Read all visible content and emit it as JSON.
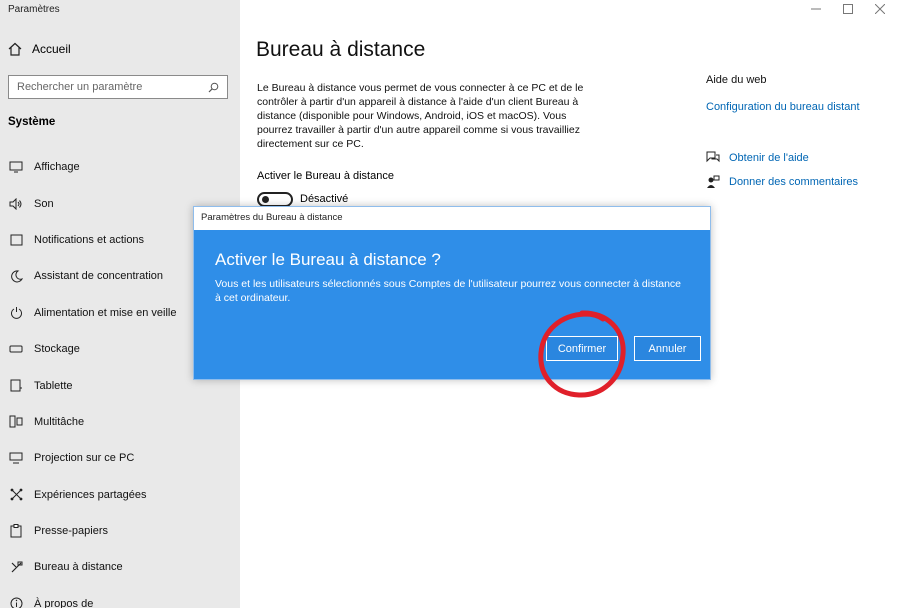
{
  "app": {
    "title": "Paramètres",
    "window_controls": [
      "minimize-icon",
      "maximize-icon",
      "close-icon"
    ]
  },
  "sidebar": {
    "home_label": "Accueil",
    "search_placeholder": "Rechercher un paramètre",
    "section": "Système",
    "items": [
      {
        "label": "Affichage",
        "icon": "display-icon"
      },
      {
        "label": "Son",
        "icon": "sound-icon"
      },
      {
        "label": "Notifications et actions",
        "icon": "notifications-icon"
      },
      {
        "label": "Assistant de concentration",
        "icon": "moon-icon"
      },
      {
        "label": "Alimentation et mise en veille",
        "icon": "power-icon"
      },
      {
        "label": "Stockage",
        "icon": "storage-icon"
      },
      {
        "label": "Tablette",
        "icon": "tablet-icon"
      },
      {
        "label": "Multitâche",
        "icon": "multitask-icon"
      },
      {
        "label": "Projection sur ce PC",
        "icon": "projection-icon"
      },
      {
        "label": "Expériences partagées",
        "icon": "shared-icon"
      },
      {
        "label": "Presse-papiers",
        "icon": "clipboard-icon"
      },
      {
        "label": "Bureau à distance",
        "icon": "remote-desktop-icon"
      },
      {
        "label": "À propos de",
        "icon": "info-icon"
      }
    ]
  },
  "main": {
    "title": "Bureau à distance",
    "description": "Le Bureau à distance vous permet de vous connecter à ce PC et de le contrôler à partir d'un appareil à distance à l'aide d'un client Bureau à distance (disponible pour Windows, Android, iOS et macOS). Vous pourrez travailler à partir d'un autre appareil comme si vous travailliez directement sur ce PC.",
    "toggle_label": "Activer le Bureau à distance",
    "toggle_state": "Désactivé"
  },
  "help": {
    "title": "Aide du web",
    "link": "Configuration du bureau distant",
    "get_help": "Obtenir de l'aide",
    "feedback": "Donner des commentaires"
  },
  "dialog": {
    "window_title": "Paramètres du Bureau à distance",
    "heading": "Activer le Bureau à distance ?",
    "message": "Vous et les utilisateurs sélectionnés sous Comptes de l'utilisateur pourrez vous connecter à distance à cet ordinateur.",
    "confirm_label": "Confirmer",
    "cancel_label": "Annuler"
  },
  "colors": {
    "dialog_bg": "#2f8ee8",
    "link": "#0066b4",
    "sidebar_bg": "#e9e9e9",
    "annotation": "#e0202a"
  }
}
